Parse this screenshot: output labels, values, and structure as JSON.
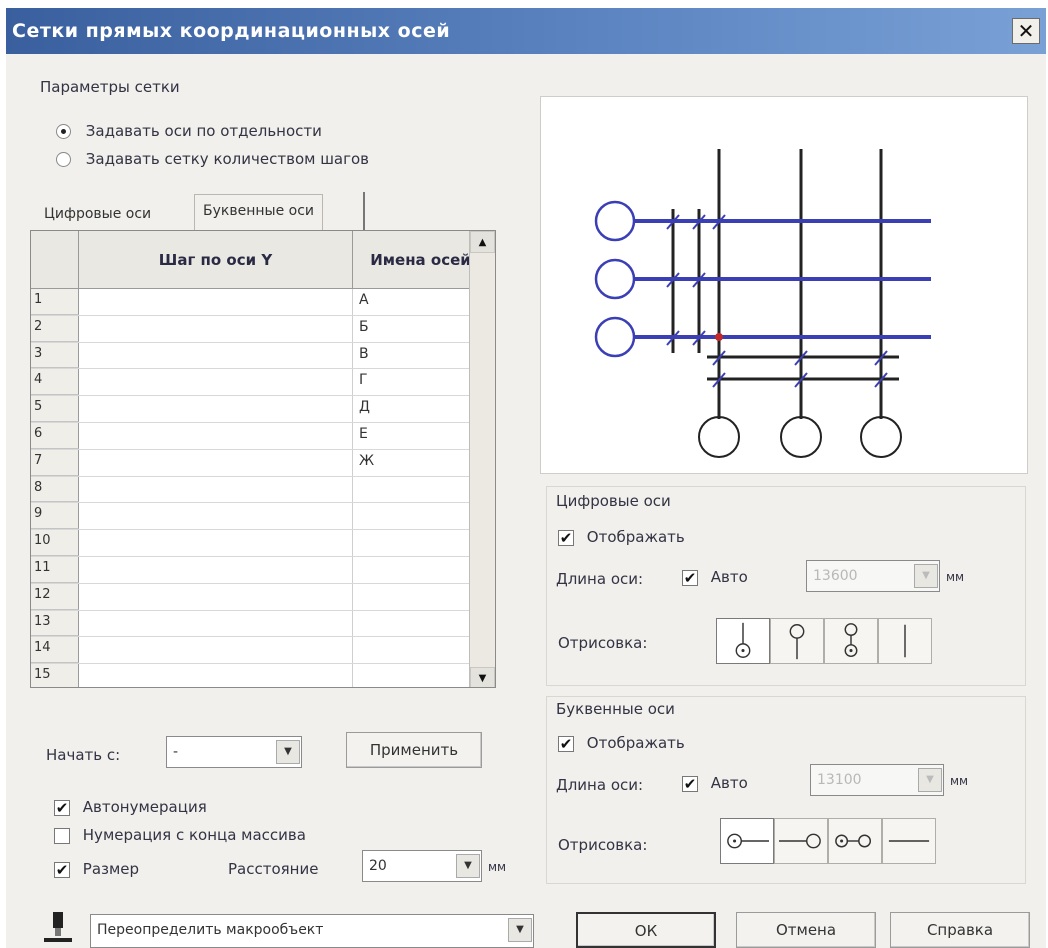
{
  "window": {
    "title": "Сетки прямых координационных осей",
    "close": "✕"
  },
  "params": {
    "label": "Параметры сетки",
    "radio1": "Задавать оси по отдельности",
    "radio2": "Задавать сетку количеством шагов"
  },
  "tabs": [
    "Цифровые оси",
    "Буквенные оси"
  ],
  "grid": {
    "col_step": "Шаг по оси Y",
    "col_names": "Имена осей",
    "rows": [
      {
        "n": "1",
        "name": "А"
      },
      {
        "n": "2",
        "name": "Б"
      },
      {
        "n": "3",
        "name": "В"
      },
      {
        "n": "4",
        "name": "Г"
      },
      {
        "n": "5",
        "name": "Д"
      },
      {
        "n": "6",
        "name": "Е"
      },
      {
        "n": "7",
        "name": "Ж"
      },
      {
        "n": "8",
        "name": ""
      },
      {
        "n": "9",
        "name": ""
      },
      {
        "n": "10",
        "name": ""
      },
      {
        "n": "11",
        "name": ""
      },
      {
        "n": "12",
        "name": ""
      },
      {
        "n": "13",
        "name": ""
      },
      {
        "n": "14",
        "name": ""
      },
      {
        "n": "15",
        "name": ""
      }
    ]
  },
  "start": {
    "label": "Начать с:",
    "value": "-",
    "apply": "Применить"
  },
  "options": {
    "autonum": "Автонумерация",
    "from_end": "Нумерация с конца массива",
    "size": "Размер",
    "distance_label": "Расстояние",
    "distance_value": "20",
    "unit": "мм"
  },
  "digital_axes": {
    "title": "Цифровые оси",
    "show": "Отображать",
    "length_label": "Длина оси:",
    "auto": "Авто",
    "length_value": "13600",
    "unit": "мм",
    "draw_label": "Отрисовка:"
  },
  "letter_axes": {
    "title": "Буквенные оси",
    "show": "Отображать",
    "length_label": "Длина оси:",
    "auto": "Авто",
    "length_value": "13100",
    "unit": "мм",
    "draw_label": "Отрисовка:"
  },
  "bottom": {
    "macro_value": "Переопределить макрообъект",
    "ok": "ОК",
    "cancel": "Отмена",
    "help": "Справка"
  },
  "colors": {
    "title_bar": "#3a5f9e",
    "axis_blue": "#3b3fb5",
    "axis_dark": "#222222"
  }
}
